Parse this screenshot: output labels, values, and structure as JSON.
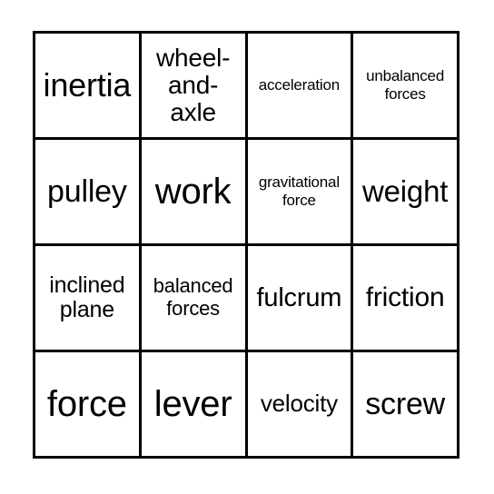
{
  "card": {
    "type": "bingo-card",
    "columns": 4,
    "rows": 4,
    "border_color": "#000000",
    "background_color": "#ffffff",
    "text_color": "#000000",
    "cells": [
      {
        "text": "inertia",
        "size_class": "fs-xl"
      },
      {
        "text": "wheel-\nand-\naxle",
        "size_class": "fs-ms"
      },
      {
        "text": "acceleration",
        "size_class": "fs-xxs"
      },
      {
        "text": "unbalanced\nforces",
        "size_class": "fs-xxs"
      },
      {
        "text": "pulley",
        "size_class": "fs-l"
      },
      {
        "text": "work",
        "size_class": "fs-xxl"
      },
      {
        "text": "gravitational\nforce",
        "size_class": "fs-xxs"
      },
      {
        "text": "weight",
        "size_class": "fs-ml"
      },
      {
        "text": "inclined\nplane",
        "size_class": "fs-s2"
      },
      {
        "text": "balanced\nforces",
        "size_class": "fs-xs"
      },
      {
        "text": "fulcrum",
        "size_class": "fs-m2"
      },
      {
        "text": "friction",
        "size_class": "fs-m"
      },
      {
        "text": "force",
        "size_class": "fs-xxl"
      },
      {
        "text": "lever",
        "size_class": "fs-xxl"
      },
      {
        "text": "velocity",
        "size_class": "fs-s"
      },
      {
        "text": "screw",
        "size_class": "fs-l"
      }
    ]
  }
}
